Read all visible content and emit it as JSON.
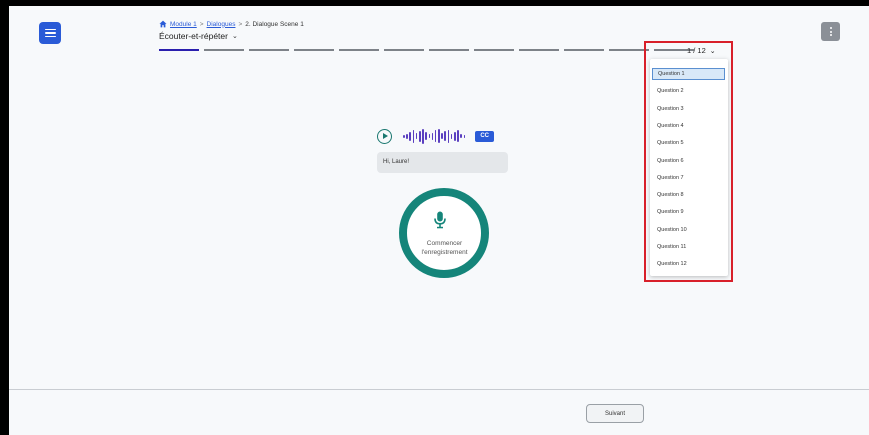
{
  "breadcrumb": {
    "module": "Module 1",
    "section": "Dialogues",
    "current": "2. Dialogue Scene 1",
    "separator": ">"
  },
  "activity": {
    "label": "Écouter-et-répéter"
  },
  "progress": {
    "total_steps": 12,
    "current_step": 1
  },
  "question_selector": {
    "current_label": "1 / 12",
    "options": [
      "Question 1",
      "Question 2",
      "Question 3",
      "Question 4",
      "Question 5",
      "Question 6",
      "Question 7",
      "Question 8",
      "Question 9",
      "Question 10",
      "Question 11",
      "Question 12"
    ],
    "selected_index": 0
  },
  "audio": {
    "cc_label": "CC"
  },
  "transcript": {
    "text": "Hi, Laure!"
  },
  "recorder": {
    "label_line1": "Commencer",
    "label_line2": "l'enregistrement"
  },
  "footer": {
    "next_label": "Suivant"
  },
  "colors": {
    "primary": "#2a5bd7",
    "progress_active": "#2a1fae",
    "record_ring": "#15857a",
    "waveform": "#5a3fc0",
    "highlight": "#d8202a"
  },
  "icons": {
    "menu": "menu-icon",
    "more": "more-vertical-icon",
    "home": "home-icon",
    "play": "play-icon",
    "mic": "microphone-icon",
    "chevron": "chevron-down-icon"
  }
}
